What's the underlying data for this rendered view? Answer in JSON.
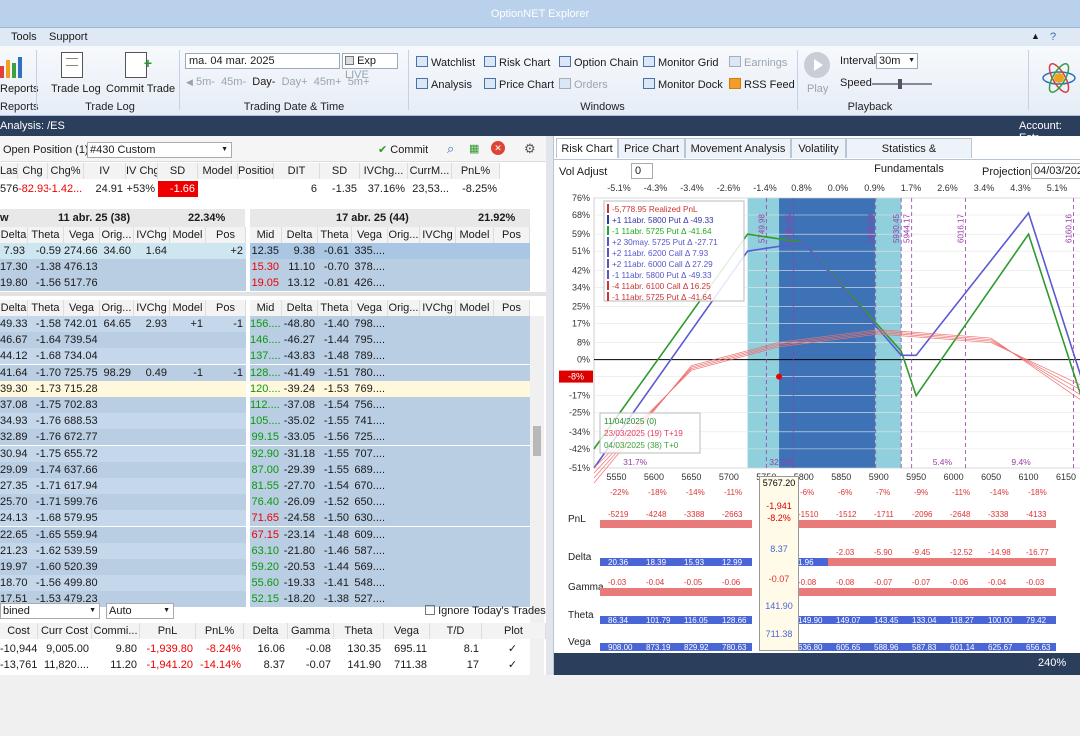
{
  "app": {
    "title": "OptionNET Explorer"
  },
  "menu": [
    "Tools",
    "Support"
  ],
  "ribbon": {
    "reports": "Reports",
    "reports_group": "Reports",
    "trade_log": "Trade Log",
    "commit_trade": "Commit Trade",
    "trade_log_group": "Trade Log",
    "date": "ma. 04 mar. 2025",
    "exp": "Exp",
    "live": "LIVE",
    "steps": [
      "5m-",
      "45m-",
      "Day-",
      "Day+",
      "45m+",
      "5m+"
    ],
    "date_group": "Trading Date & Time",
    "windows": [
      "Watchlist",
      "Risk Chart",
      "Option Chain",
      "Monitor Grid",
      "Earnings",
      "Analysis",
      "Price Chart",
      "Orders",
      "Monitor Dock",
      "RSS Feed"
    ],
    "windows_group": "Windows",
    "play": "Play",
    "interval_label": "Interval",
    "interval": "30m",
    "speed_label": "Speed",
    "playback_group": "Playback"
  },
  "analysis_bar": {
    "left": "Analysis: /ES",
    "right": "Account: Estr"
  },
  "left": {
    "open_position": "Open Position (1)",
    "position_select": "#430 Custom",
    "commit": "Commit",
    "sum_headers": [
      "Last",
      "Chg",
      "Chg%",
      "IV",
      "IV Chg",
      "SD",
      "Model",
      "Position",
      "DIT",
      "SD",
      "IVChg...",
      "CurrM...",
      "PnL%"
    ],
    "sum_values": [
      "5766...",
      "-82.93",
      "-1.42...",
      "24.91",
      "+53%",
      "-1.66",
      "",
      "",
      "6",
      "-1.35",
      "37.16%",
      "23,53...",
      "-8.25%"
    ],
    "exp1": {
      "label": "w",
      "date": "11 abr. 25 (38)",
      "pct": "22.34%"
    },
    "exp2": {
      "date": "17 abr. 25 (44)",
      "pct": "21.92%"
    },
    "chain_headers_l": [
      "Delta",
      "Theta",
      "Vega",
      "Orig...",
      "IVChg",
      "Model",
      "Pos"
    ],
    "chain_headers_r": [
      "Mid",
      "Delta",
      "Theta",
      "Vega",
      "Orig...",
      "IVChg",
      "Model",
      "Pos"
    ],
    "top_rows": [
      [
        "7.93",
        "-0.59",
        "274.66",
        "34.60",
        "1.64",
        "",
        "+2",
        "12.35",
        "9.38",
        "-0.61",
        "335...."
      ],
      [
        "17.30",
        "-1.38",
        "476.13",
        "",
        "",
        "",
        "",
        "15.30",
        "11.10",
        "-0.70",
        "378...."
      ],
      [
        "19.80",
        "-1.56",
        "517.76",
        "",
        "",
        "",
        "",
        "19.05",
        "13.12",
        "-0.81",
        "426...."
      ]
    ],
    "rows": [
      [
        "49.33",
        "-1.58",
        "742.01",
        "64.65",
        "2.93",
        "+1",
        "-1",
        "156....",
        "-48.80",
        "-1.40",
        "798...."
      ],
      [
        "46.67",
        "-1.64",
        "739.54",
        "",
        "",
        "",
        "",
        "146....",
        "-46.27",
        "-1.44",
        "795...."
      ],
      [
        "44.12",
        "-1.68",
        "734.04",
        "",
        "",
        "",
        "",
        "137....",
        "-43.83",
        "-1.48",
        "789...."
      ],
      [
        "41.64",
        "-1.70",
        "725.75",
        "98.29",
        "0.49",
        "-1",
        "-1",
        "128....",
        "-41.49",
        "-1.51",
        "780...."
      ],
      [
        "39.30",
        "-1.73",
        "715.28",
        "",
        "",
        "",
        "",
        "120....",
        "-39.24",
        "-1.53",
        "769...."
      ],
      [
        "37.08",
        "-1.75",
        "702.83",
        "",
        "",
        "",
        "",
        "112....",
        "-37.08",
        "-1.54",
        "756...."
      ],
      [
        "34.93",
        "-1.76",
        "688.53",
        "",
        "",
        "",
        "",
        "105....",
        "-35.02",
        "-1.55",
        "741...."
      ],
      [
        "32.89",
        "-1.76",
        "672.77",
        "",
        "",
        "",
        "",
        "99.15",
        "-33.05",
        "-1.56",
        "725...."
      ],
      [
        "30.94",
        "-1.75",
        "655.72",
        "",
        "",
        "",
        "",
        "92.90",
        "-31.18",
        "-1.55",
        "707...."
      ],
      [
        "29.09",
        "-1.74",
        "637.66",
        "",
        "",
        "",
        "",
        "87.00",
        "-29.39",
        "-1.55",
        "689...."
      ],
      [
        "27.35",
        "-1.71",
        "617.94",
        "",
        "",
        "",
        "",
        "81.55",
        "-27.70",
        "-1.54",
        "670...."
      ],
      [
        "25.70",
        "-1.71",
        "599.76",
        "",
        "",
        "",
        "",
        "76.40",
        "-26.09",
        "-1.52",
        "650...."
      ],
      [
        "24.13",
        "-1.68",
        "579.95",
        "",
        "",
        "",
        "",
        "71.65",
        "-24.58",
        "-1.50",
        "630...."
      ],
      [
        "22.65",
        "-1.65",
        "559.94",
        "",
        "",
        "",
        "",
        "67.15",
        "-23.14",
        "-1.48",
        "609...."
      ],
      [
        "21.23",
        "-1.62",
        "539.59",
        "",
        "",
        "",
        "",
        "63.10",
        "-21.80",
        "-1.46",
        "587...."
      ],
      [
        "19.97",
        "-1.60",
        "520.39",
        "",
        "",
        "",
        "",
        "59.20",
        "-20.53",
        "-1.44",
        "569...."
      ],
      [
        "18.70",
        "-1.56",
        "499.80",
        "",
        "",
        "",
        "",
        "55.60",
        "-19.33",
        "-1.41",
        "548...."
      ],
      [
        "17.51",
        "-1.53",
        "479.23",
        "",
        "",
        "",
        "",
        "52.15",
        "-18.20",
        "-1.38",
        "527...."
      ]
    ],
    "bottom": {
      "combine": "bined",
      "auto": "Auto",
      "ignore": "Ignore Today's Trades",
      "headers": [
        "Cost",
        "Curr Cost",
        "Commi...",
        "PnL",
        "PnL%",
        "Delta",
        "Gamma",
        "Theta",
        "Vega",
        "T/D",
        "Plot"
      ],
      "rows": [
        [
          "-10,944...",
          "9,005.00",
          "9.80",
          "-1,939.80",
          "-8.24%",
          "16.06",
          "-0.08",
          "130.35",
          "695.11",
          "8.1",
          "✓"
        ],
        [
          "-13,761...",
          "11,820....",
          "11.20",
          "-1,941.20",
          "-14.14%",
          "8.37",
          "-0.07",
          "141.90",
          "711.38",
          "17",
          "✓"
        ]
      ]
    }
  },
  "right": {
    "tabs": [
      "Risk Chart",
      "Price Chart",
      "Movement Analysis",
      "Volatility",
      "Statistics & Fundamentals"
    ],
    "vol_adjust": "Vol Adjust",
    "vol_value": "0",
    "projection_label": "Projection",
    "projection": "04/03/2025",
    "top_pcts": [
      "-5.1%",
      "-4.3%",
      "-3.4%",
      "-2.6%",
      "-1.4%",
      "0.8%",
      "0.0%",
      "0.9%",
      "1.7%",
      "2.6%",
      "3.4%",
      "4.3%",
      "5.1%"
    ],
    "legend": [
      "-5,778.95 Realized PnL",
      "+1  11abr.  5800 Put Δ  -49.33",
      "-1  11abr.  5725 Put Δ  -41.64",
      "+2  30may.  5725 Put Δ  -27.71",
      "+2  11abr.  6200 Call Δ  7.93",
      "+2  11abr.  6000 Call Δ  27.29",
      "-1  11abr.  5800 Put Δ  -49.33",
      "-4  11abr.  6100 Call Δ  16.25",
      "-1  11abr.  5725 Put Δ  -41.64"
    ],
    "date_legend": [
      "11/04/2025 (0)",
      "23/03/2025 (19) T+19",
      "04/03/2025 (38) T+0"
    ],
    "price_marker": "5767.20",
    "pnl_marker": "-1,941",
    "pnl_pct_marker": "-8.2%",
    "cur_pct": "-8%",
    "vlines": [
      "5749.98",
      "5785.65",
      "5895.59",
      "5930.45",
      "5944.17",
      "6016.17",
      "6160.16"
    ],
    "bottom_pcts": [
      "31.7%",
      "32.2%",
      "5.4%",
      "9.4%"
    ],
    "greeks": {
      "pnl": "PnL",
      "delta": "Delta",
      "gamma": "Gamma",
      "theta": "Theta",
      "vega": "Vega",
      "pnl_pct": [
        "-22%",
        "-18%",
        "-14%",
        "-11%",
        "",
        "-6%",
        "-6%",
        "-7%",
        "-9%",
        "-11%",
        "-14%",
        "-18%"
      ],
      "pnl_val": [
        "-5219",
        "-4248",
        "-3388",
        "-2663",
        "",
        "-1510",
        "-1512",
        "-1711",
        "-2096",
        "-2648",
        "-3338",
        "-4133"
      ],
      "delta_val": [
        "20.36",
        "18.39",
        "15.93",
        "12.99",
        "",
        "1.96",
        "-2.03",
        "-5.90",
        "-9.45",
        "-12.52",
        "-14.98",
        "-16.77"
      ],
      "gamma_val": [
        "-0.03",
        "-0.04",
        "-0.05",
        "-0.06",
        "",
        "-0.08",
        "-0.08",
        "-0.07",
        "-0.07",
        "-0.06",
        "-0.04",
        "-0.03"
      ],
      "theta_val": [
        "86.34",
        "101.79",
        "116.05",
        "128.66",
        "",
        "149.90",
        "149.07",
        "143.45",
        "133.04",
        "118.27",
        "100.00",
        "79.42"
      ],
      "vega_val": [
        "908.00",
        "873.19",
        "829.92",
        "780.63",
        "",
        "636.80",
        "605.65",
        "588.96",
        "587.83",
        "601.14",
        "625.67",
        "656.63"
      ],
      "mid_delta": "8.37",
      "mid_gamma": "-0.07",
      "mid_theta": "141.90",
      "mid_vega": "711.38"
    },
    "zoom": "240%"
  },
  "chart_data": {
    "type": "line",
    "x_ticks": [
      "5550",
      "5600",
      "5650",
      "5700",
      "5750",
      "5800",
      "5850",
      "5900",
      "5950",
      "6000",
      "6050",
      "6100",
      "6150"
    ],
    "y_ticks": [
      "76%",
      "68%",
      "59%",
      "51%",
      "42%",
      "34%",
      "25%",
      "17%",
      "8%",
      "0%",
      "-8%",
      "-17%",
      "-25%",
      "-34%",
      "-42%",
      "-51%"
    ],
    "xlim": [
      5520,
      6170
    ],
    "ylim": [
      -51,
      76
    ],
    "series": [
      {
        "name": "11/04/2025 (0)",
        "color": "#2f9a2f",
        "x": [
          5520,
          5725,
          5800,
          5930,
          5950,
          6100,
          6170
        ],
        "y": [
          -42,
          59,
          55,
          4,
          -17,
          59,
          -17
        ]
      },
      {
        "name": "04/03/2025 (38) T+0",
        "color": "#5a5ad2",
        "x": [
          5520,
          5725,
          5800,
          5930,
          5950,
          6100,
          6170
        ],
        "y": [
          -51,
          51,
          55,
          2,
          2,
          69,
          -8
        ]
      },
      {
        "name": "23/03/2025 (19) T+19",
        "color": "#e05050",
        "x": [
          5520,
          5650,
          5767,
          5900,
          6050,
          6170
        ],
        "y": [
          -51,
          -5,
          6,
          12,
          8,
          -12
        ]
      }
    ]
  }
}
